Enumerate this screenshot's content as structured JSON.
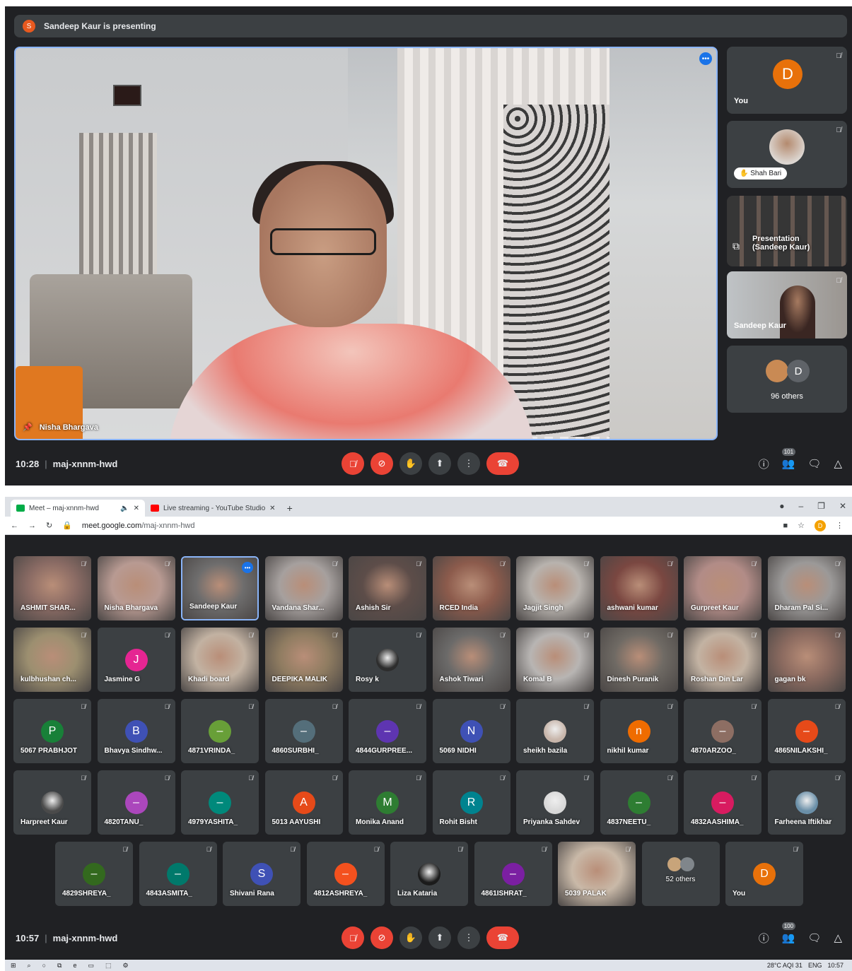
{
  "top": {
    "banner": {
      "initial": "S",
      "text": "Sandeep Kaur is presenting"
    },
    "main": {
      "name": "Nisha Bhargava"
    },
    "side_tiles": [
      {
        "type": "avatar",
        "initial": "D",
        "name": "You",
        "color": "#e8710a"
      },
      {
        "type": "photo",
        "name": "Shah Bari"
      },
      {
        "type": "presentation",
        "name": "Presentation (Sandeep Kaur)"
      },
      {
        "type": "video",
        "name": "Sandeep Kaur"
      },
      {
        "type": "others",
        "initial": "D",
        "name": "96 others"
      }
    ],
    "controls": {
      "time": "10:28",
      "code": "maj-xnnm-hwd",
      "people_count": "101"
    }
  },
  "browser": {
    "tabs": [
      {
        "title": "Meet – maj-xnnm-hwd"
      },
      {
        "title": "Live streaming - YouTube Studio"
      }
    ],
    "url_host": "meet.google.com",
    "url_path": "/maj-xnnm-hwd",
    "profile_initial": "D"
  },
  "grid": {
    "rows": [
      [
        {
          "name": "ASHMIT SHAR...",
          "kind": "video",
          "bg": "#8a6b64"
        },
        {
          "name": "Nisha Bhargava",
          "kind": "video",
          "bg": "#b89a92"
        },
        {
          "name": "Sandeep Kaur",
          "kind": "video",
          "bg": "#6e6d6d",
          "speaking": true
        },
        {
          "name": "Vandana Shar...",
          "kind": "video",
          "bg": "#a6a09e"
        },
        {
          "name": "Ashish Sir",
          "kind": "video",
          "bg": "#5d4d49"
        },
        {
          "name": "RCED India",
          "kind": "video",
          "bg": "#8c5b4c"
        },
        {
          "name": "Jagjit Singh",
          "kind": "video",
          "bg": "#b8b3ae"
        },
        {
          "name": "ashwani kumar",
          "kind": "video",
          "bg": "#7a4741"
        },
        {
          "name": "Gurpreet Kaur",
          "kind": "video",
          "bg": "#b28c87"
        },
        {
          "name": "Dharam Pal Si...",
          "kind": "video",
          "bg": "#9b9998"
        }
      ],
      [
        {
          "name": "kulbhushan ch...",
          "kind": "video",
          "bg": "#9c8f70"
        },
        {
          "name": "Jasmine G",
          "kind": "avatar",
          "initial": "J",
          "color": "#e52592"
        },
        {
          "name": "Khadi board",
          "kind": "video",
          "bg": "#c2b2a2"
        },
        {
          "name": "DEEPIKA MALIK",
          "kind": "video",
          "bg": "#8f7c61"
        },
        {
          "name": "Rosy k",
          "kind": "photo",
          "color": "#2d2d2d"
        },
        {
          "name": "Ashok Tiwari",
          "kind": "video",
          "bg": "#6b6a69"
        },
        {
          "name": "Komal B",
          "kind": "video",
          "bg": "#b8b5b3"
        },
        {
          "name": "Dinesh Puranik",
          "kind": "video",
          "bg": "#6f6a64"
        },
        {
          "name": "Roshan Din Lar",
          "kind": "video",
          "bg": "#c3b3a3"
        },
        {
          "name": "gagan bk",
          "kind": "video",
          "bg": "#8c6b60"
        }
      ],
      [
        {
          "name": "5067 PRABHJOT",
          "kind": "avatar",
          "initial": "P",
          "color": "#188038"
        },
        {
          "name": "Bhavya Sindhw...",
          "kind": "avatar",
          "initial": "B",
          "color": "#3f51b5"
        },
        {
          "name": "4871VRINDA_",
          "kind": "avatar",
          "initial": "–",
          "color": "#689f38"
        },
        {
          "name": "4860SURBHI_",
          "kind": "avatar",
          "initial": "–",
          "color": "#546e7a"
        },
        {
          "name": "4844GURPREE...",
          "kind": "avatar",
          "initial": "–",
          "color": "#5e35b1"
        },
        {
          "name": "5069 NIDHI",
          "kind": "avatar",
          "initial": "N",
          "color": "#3f51b5"
        },
        {
          "name": "sheikh bazila",
          "kind": "photo",
          "color": "#c8b6ab"
        },
        {
          "name": "nikhil kumar",
          "kind": "avatar",
          "initial": "n",
          "color": "#ef6c00"
        },
        {
          "name": "4870ARZOO_",
          "kind": "avatar",
          "initial": "–",
          "color": "#8d6e63"
        },
        {
          "name": "4865NILAKSHI_",
          "kind": "avatar",
          "initial": "–",
          "color": "#e64a19"
        }
      ],
      [
        {
          "name": "Harpreet Kaur",
          "kind": "photo",
          "color": "#4a4a4a"
        },
        {
          "name": "4820TANU_",
          "kind": "avatar",
          "initial": "–",
          "color": "#ab47bc"
        },
        {
          "name": "4979YASHITA_",
          "kind": "avatar",
          "initial": "–",
          "color": "#00897b"
        },
        {
          "name": "5013 AAYUSHI",
          "kind": "avatar",
          "initial": "A",
          "color": "#e64a19"
        },
        {
          "name": "Monika Anand",
          "kind": "avatar",
          "initial": "M",
          "color": "#2e7d32"
        },
        {
          "name": "Rohit Bisht",
          "kind": "avatar",
          "initial": "R",
          "color": "#00838f"
        },
        {
          "name": "Priyanka Sahdev",
          "kind": "photo",
          "color": "#d8d8d8"
        },
        {
          "name": "4837NEETU_",
          "kind": "avatar",
          "initial": "–",
          "color": "#2e7d32"
        },
        {
          "name": "4832AASHIMA_",
          "kind": "avatar",
          "initial": "–",
          "color": "#d81b60"
        },
        {
          "name": "Farheena Iftikhar",
          "kind": "photo",
          "color": "#6a8fa8"
        }
      ],
      [
        {
          "name": "4829SHREYA_",
          "kind": "avatar",
          "initial": "–",
          "color": "#33691e"
        },
        {
          "name": "4843ASMITA_",
          "kind": "avatar",
          "initial": "–",
          "color": "#00796b"
        },
        {
          "name": "Shivani Rana",
          "kind": "avatar",
          "initial": "S",
          "color": "#3f51b5"
        },
        {
          "name": "4812ASHREYA_",
          "kind": "avatar",
          "initial": "–",
          "color": "#f4511e"
        },
        {
          "name": "Liza Kataria",
          "kind": "photo",
          "color": "#1b1b1b"
        },
        {
          "name": "4861ISHRAT_",
          "kind": "avatar",
          "initial": "–",
          "color": "#7b1fa2"
        },
        {
          "name": "5039 PALAK",
          "kind": "video",
          "bg": "#c9b9a8"
        },
        {
          "name": "52 others",
          "kind": "others"
        },
        {
          "name": "You",
          "kind": "avatar",
          "initial": "D",
          "color": "#e8710a"
        }
      ]
    ]
  },
  "bottom_controls": {
    "time": "10:57",
    "code": "maj-xnnm-hwd",
    "people_count": "100"
  },
  "taskbar": {
    "weather": "28°C AQI 31",
    "lang": "ENG",
    "clock": "10:57"
  }
}
